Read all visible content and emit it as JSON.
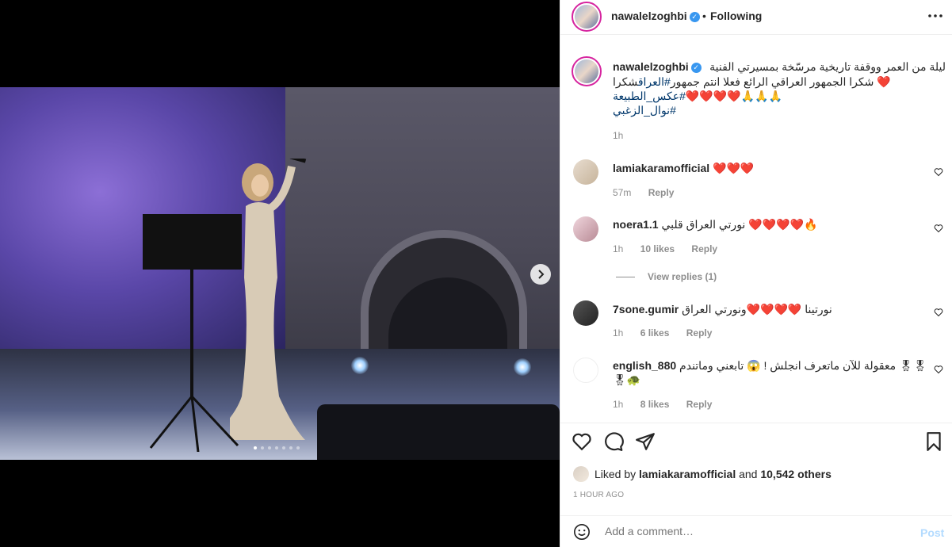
{
  "header": {
    "username": "nawalelzoghbi",
    "separator": "•",
    "follow_status": "Following",
    "more": "•••"
  },
  "carousel": {
    "slide_count": 7,
    "active_index": 0
  },
  "caption": {
    "username": "nawalelzoghbi",
    "line1": "ليلة من العمر ووقفة تاريخية مرسّخة بمسيرتي الفنية",
    "line2_a": "شكرا ",
    "line2_hashtag": "#العراق",
    "line2_b": " شكرا الجمهور العراقي الرائع فعلا انتم جمهور",
    "line2_hearts": "❤️",
    "line3_hashtag": "#عكس_الطبيعة",
    "line3_emojis": "🙏🙏🙏❤️❤️❤️❤️",
    "line4_hashtag": "#نوال_الزغبي",
    "time": "1h"
  },
  "comments": [
    {
      "username": "lamiakaramofficial",
      "text": "❤️❤️❤️",
      "time": "57m",
      "likes": "",
      "reply": "Reply"
    },
    {
      "username": "noera1.1",
      "text": "نورتي العراق قلبي ❤️❤️❤️❤️🔥",
      "time": "1h",
      "likes": "10 likes",
      "reply": "Reply"
    },
    {
      "username": "7sone.gumir",
      "text": "نورتينا ❤️❤️❤️❤️ونورتي العراق",
      "time": "1h",
      "likes": "6 likes",
      "reply": "Reply"
    },
    {
      "username": "english_880",
      "text": "معقولة للآن ماتعرف انجلش ! 😱 تابعني وماتندم 🎖🎖 🎖🐢",
      "time": "1h",
      "likes": "8 likes",
      "reply": "Reply"
    }
  ],
  "view_replies": "View replies (1)",
  "likes": {
    "prefix": "Liked by ",
    "user": "lamiakaramofficial",
    "middle": " and ",
    "others": "10,542 others"
  },
  "time_ago": "1 HOUR AGO",
  "add_comment": {
    "placeholder": "Add a comment…",
    "post_label": "Post"
  },
  "colors": {
    "link": "#00376b",
    "muted": "#8e8e8e",
    "verified": "#3897f0",
    "post_disabled": "#b3dbff"
  }
}
